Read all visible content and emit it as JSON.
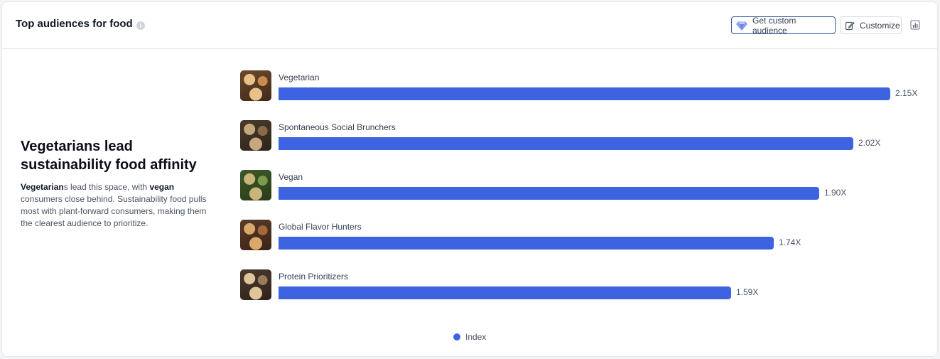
{
  "header": {
    "title": "Top audiences for food",
    "info_icon": "info-icon",
    "get_custom_label": "Get custom audience",
    "get_custom_icon": "diamond-icon",
    "customize_label": "Customize",
    "customize_icon": "edit-icon",
    "chart_toggle_icon": "bar-chart-icon"
  },
  "summary": {
    "title": "Vegetarians lead sustainability food affinity",
    "body_lead": "Vegetarian",
    "body_1": "s lead this space, with ",
    "body_bold": "vegan",
    "body_2": " consumers close behind. Sustainability food pulls most with plant-forward consumers, making them the clearest audience to prioritize."
  },
  "colors": {
    "bar": "#3e63e1",
    "accent_border": "#3e5a9e"
  },
  "chart_data": {
    "type": "bar",
    "orientation": "horizontal",
    "categories": [
      "Vegetarian",
      "Spontaneous Social Brunchers",
      "Vegan",
      "Global Flavor Hunters",
      "Protein Prioritizers"
    ],
    "series": [
      {
        "name": "Index",
        "values": [
          2.15,
          2.02,
          1.9,
          1.74,
          1.59
        ]
      }
    ],
    "value_labels": [
      "2.15X",
      "2.02X",
      "1.90X",
      "1.74X",
      "1.59X"
    ],
    "xlim": [
      0,
      2.15
    ],
    "grid": false,
    "legend": "bottom-center"
  }
}
